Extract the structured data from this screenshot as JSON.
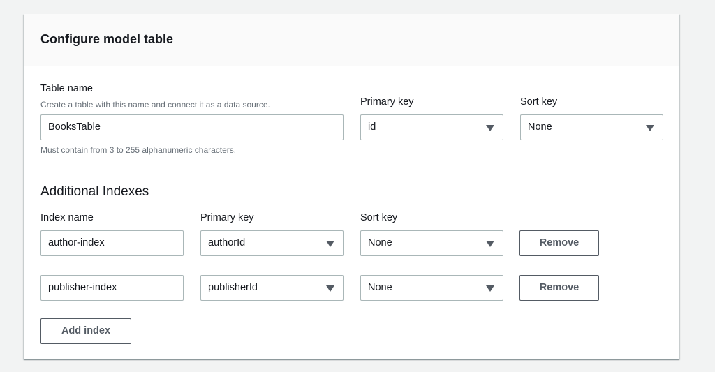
{
  "title": "Configure model table",
  "table": {
    "label": "Table name",
    "description": "Create a table with this name and connect it as a data source.",
    "value": "BooksTable",
    "hint": "Must contain from 3 to 255 alphanumeric characters.",
    "primary_key_label": "Primary key",
    "primary_key": "id",
    "sort_key_label": "Sort key",
    "sort_key": "None"
  },
  "indexes": {
    "heading": "Additional Indexes",
    "col_index_name": "Index name",
    "col_primary_key": "Primary key",
    "col_sort_key": "Sort key",
    "rows": [
      {
        "name": "author-index",
        "primary_key": "authorId",
        "sort_key": "None",
        "remove": "Remove"
      },
      {
        "name": "publisher-index",
        "primary_key": "publisherId",
        "sort_key": "None",
        "remove": "Remove"
      }
    ],
    "add_label": "Add index"
  }
}
